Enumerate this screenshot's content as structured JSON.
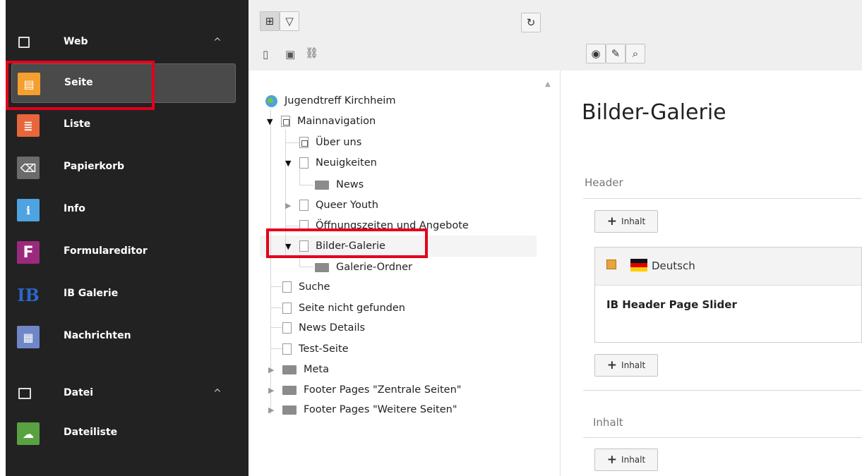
{
  "modules": {
    "web": {
      "label": "Web",
      "chevron": "^"
    },
    "items": [
      {
        "label": "Seite",
        "icon": "page-module-icon",
        "color": "#f49f2e",
        "glyph": "▤"
      },
      {
        "label": "Liste",
        "icon": "list-module-icon",
        "color": "#e8663b",
        "glyph": "≣"
      },
      {
        "label": "Papierkorb",
        "icon": "trash-module-icon",
        "color": "#6b6b6b",
        "glyph": "🗑"
      },
      {
        "label": "Info",
        "icon": "info-module-icon",
        "color": "#4ea3e0",
        "glyph": "i"
      },
      {
        "label": "Formulareditor",
        "icon": "form-editor-icon",
        "color": "#9b2a7e",
        "glyph": "F"
      },
      {
        "label": "IB Galerie",
        "icon": "ib-logo-icon",
        "color": "#1f4e9e",
        "glyph": "IB"
      },
      {
        "label": "Nachrichten",
        "icon": "news-module-icon",
        "color": "#6f86c8",
        "glyph": "▦"
      }
    ],
    "datei": {
      "label": "Datei",
      "chevron": "^"
    },
    "dateiliste": {
      "label": "Dateiliste",
      "color": "#5aa141",
      "glyph": "☁"
    }
  },
  "tree": {
    "root": "Jugendtreff Kirchheim",
    "nodes": [
      {
        "label": "Mainnavigation"
      },
      {
        "label": "Über uns"
      },
      {
        "label": "Neuigkeiten"
      },
      {
        "label": "News"
      },
      {
        "label": "Queer Youth"
      },
      {
        "label": "Öffnungszeiten und Angebote"
      },
      {
        "label": "Bilder-Galerie"
      },
      {
        "label": "Galerie-Ordner"
      },
      {
        "label": "Suche"
      },
      {
        "label": "Seite nicht gefunden"
      },
      {
        "label": "News Details"
      },
      {
        "label": "Test-Seite"
      },
      {
        "label": "Meta"
      },
      {
        "label": "Footer Pages \"Zentrale Seiten\""
      },
      {
        "label": "Footer Pages \"Weitere Seiten\""
      }
    ]
  },
  "content": {
    "title": "Bilder-Galerie",
    "header_label": "Header",
    "add_label": "Inhalt",
    "language": "Deutsch",
    "element_title": "IB Header Page Slider",
    "inhalt_label": "Inhalt"
  },
  "colors": {
    "highlight": "#e3001b",
    "sidebar": "#222222"
  }
}
